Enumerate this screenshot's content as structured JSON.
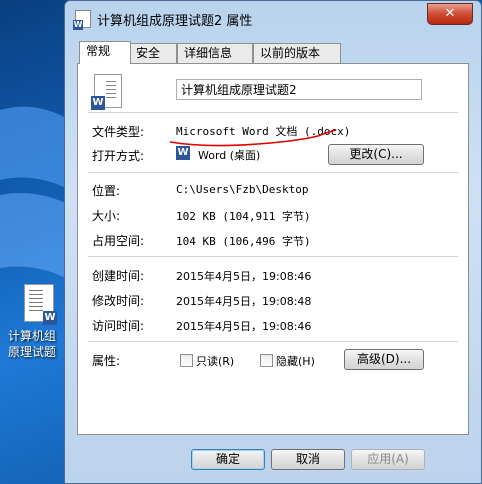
{
  "desktop": {
    "icon_label_line1": "计算机组",
    "icon_label_line2": "原理试题"
  },
  "window": {
    "title": "计算机组成原理试题2 属性",
    "close_glyph": "✕"
  },
  "tabs": [
    {
      "label": "常规",
      "active": true
    },
    {
      "label": "安全",
      "active": false
    },
    {
      "label": "详细信息",
      "active": false
    },
    {
      "label": "以前的版本",
      "active": false
    }
  ],
  "general": {
    "file_name": "计算机组成原理试题2",
    "file_type_label": "文件类型:",
    "file_type_value": "Microsoft Word 文档 (.docx)",
    "opens_with_label": "打开方式:",
    "opens_with_value": "Word (桌面)",
    "change_button": "更改(C)...",
    "location_label": "位置:",
    "location_value": "C:\\Users\\Fzb\\Desktop",
    "size_label": "大小:",
    "size_value": "102 KB (104,911 字节)",
    "size_on_disk_label": "占用空间:",
    "size_on_disk_value": "104 KB (106,496 字节)",
    "created_label": "创建时间:",
    "created_value": "2015年4月5日，19:08:46",
    "modified_label": "修改时间:",
    "modified_value": "2015年4月5日，19:08:48",
    "accessed_label": "访问时间:",
    "accessed_value": "2015年4月5日，19:08:46",
    "attributes_label": "属性:",
    "readonly_label": "只读(R)",
    "hidden_label": "隐藏(H)",
    "advanced_button": "高级(D)..."
  },
  "footer": {
    "ok_button": "确定",
    "cancel_button": "取消",
    "apply_button": "应用(A)"
  },
  "colors": {
    "annotation_underline": "#e00000",
    "word_blue": "#2b579a"
  }
}
